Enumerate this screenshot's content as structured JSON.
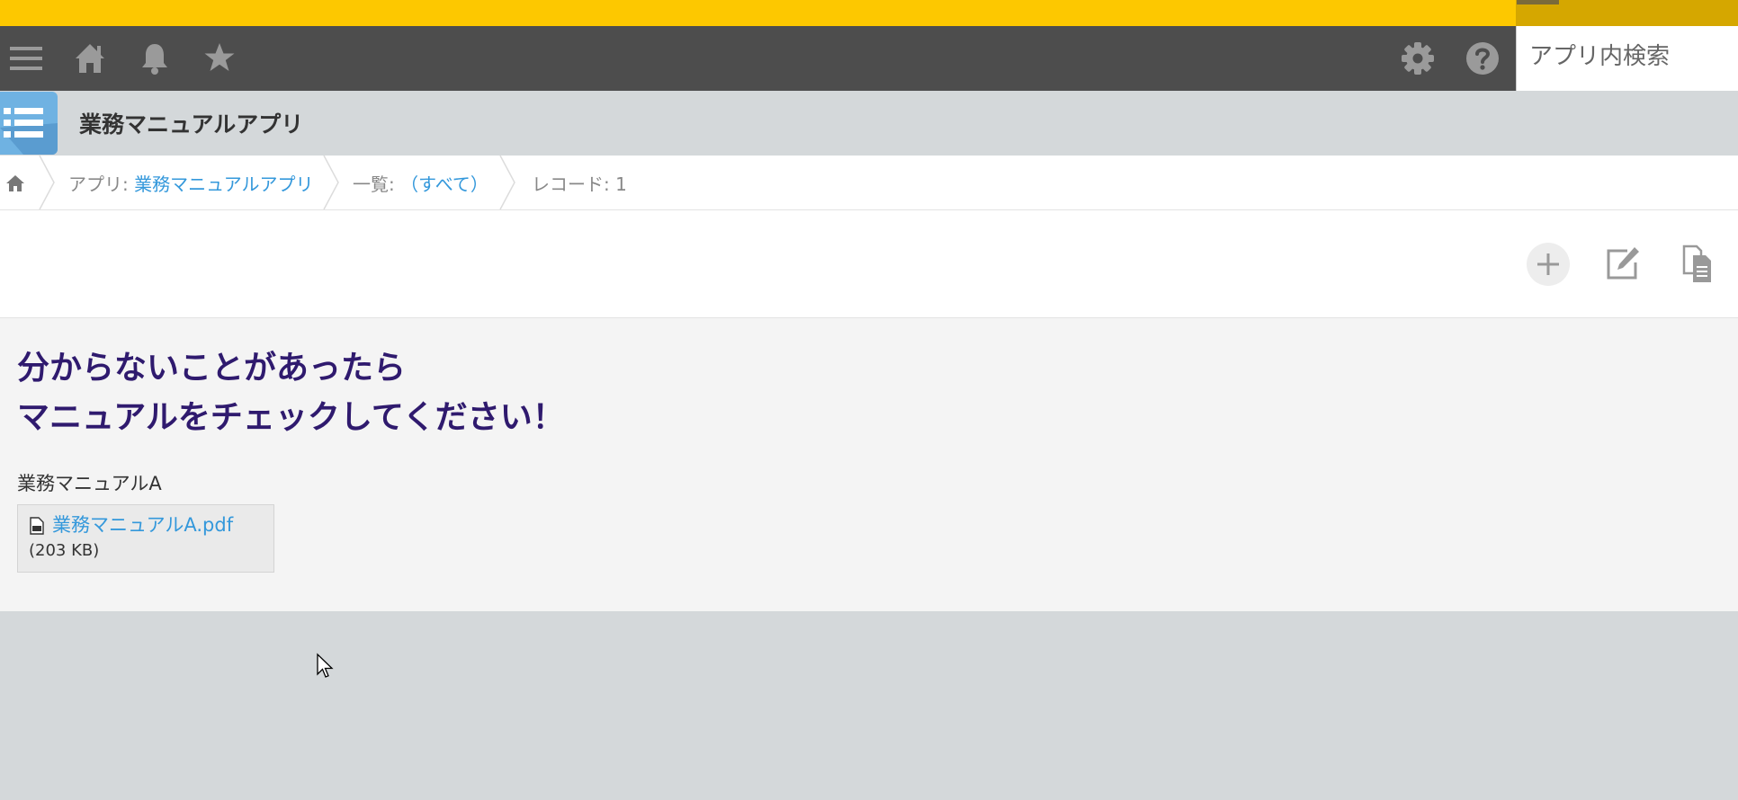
{
  "header": {
    "search_placeholder": "アプリ内検索",
    "icons": [
      "menu-icon",
      "home-icon",
      "bell-icon",
      "star-icon",
      "gear-icon",
      "help-icon"
    ]
  },
  "app": {
    "title": "業務マニュアルアプリ",
    "icon": "list-icon"
  },
  "breadcrumb": {
    "app_prefix": "アプリ: ",
    "app_name": "業務マニュアルアプリ",
    "view_prefix": "一覧: ",
    "view_name": "（すべて）",
    "record": "レコード: 1"
  },
  "toolbar": {
    "icons": [
      "add-icon",
      "edit-icon",
      "duplicate-icon"
    ]
  },
  "record": {
    "heading_line1": "分からないことがあったら",
    "heading_line2": "マニュアルをチェックしてください！",
    "field_label": "業務マニュアルA",
    "file_name": "業務マニュアルA.pdf",
    "file_size": "(203 KB)"
  },
  "colors": {
    "top_accent": "#fdc800",
    "header_bg": "#4d4d4d",
    "link": "#3498db",
    "heading": "#2f1a6e"
  }
}
